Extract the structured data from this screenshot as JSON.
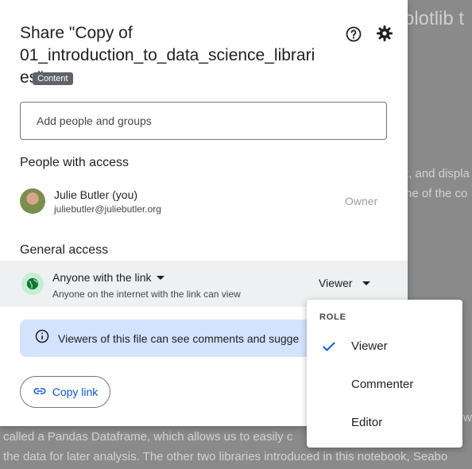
{
  "background": {
    "title_fragment": "plotlib t",
    "lines": [
      "t, and displa",
      "ne of the co",
      "called a Pandas Dataframe, which allows us to easily c",
      "the data for later analysis. The other two libraries introduced in this notebook, Seabo"
    ],
    "edge_word": "wa"
  },
  "dialog": {
    "title_lines": [
      "Share \"Copy of",
      "01_introduction_to_data_science_librari",
      "es\""
    ],
    "tooltip": "Content",
    "add_placeholder": "Add people and groups",
    "people_heading": "People with access",
    "person": {
      "name": "Julie Butler (you)",
      "email": "juliebutler@juliebutler.org",
      "role": "Owner"
    },
    "general_heading": "General access",
    "access": {
      "label": "Anyone with the link",
      "sublabel": "Anyone on the internet with the link can view",
      "role": "Viewer"
    },
    "info_text": "Viewers of this file can see comments and sugge",
    "copy_link": "Copy link"
  },
  "role_menu": {
    "heading": "ROLE",
    "items": [
      {
        "label": "Viewer",
        "selected": true
      },
      {
        "label": "Commenter",
        "selected": false
      },
      {
        "label": "Editor",
        "selected": false
      }
    ]
  },
  "colors": {
    "accent": "#0b57d0",
    "banner": "#d3e3fd",
    "globe_bg": "#c4eed0",
    "globe": "#137333"
  },
  "icons": [
    "help-icon",
    "gear-icon",
    "globe-icon",
    "info-icon",
    "link-icon",
    "check-icon",
    "caret-down-icon"
  ]
}
